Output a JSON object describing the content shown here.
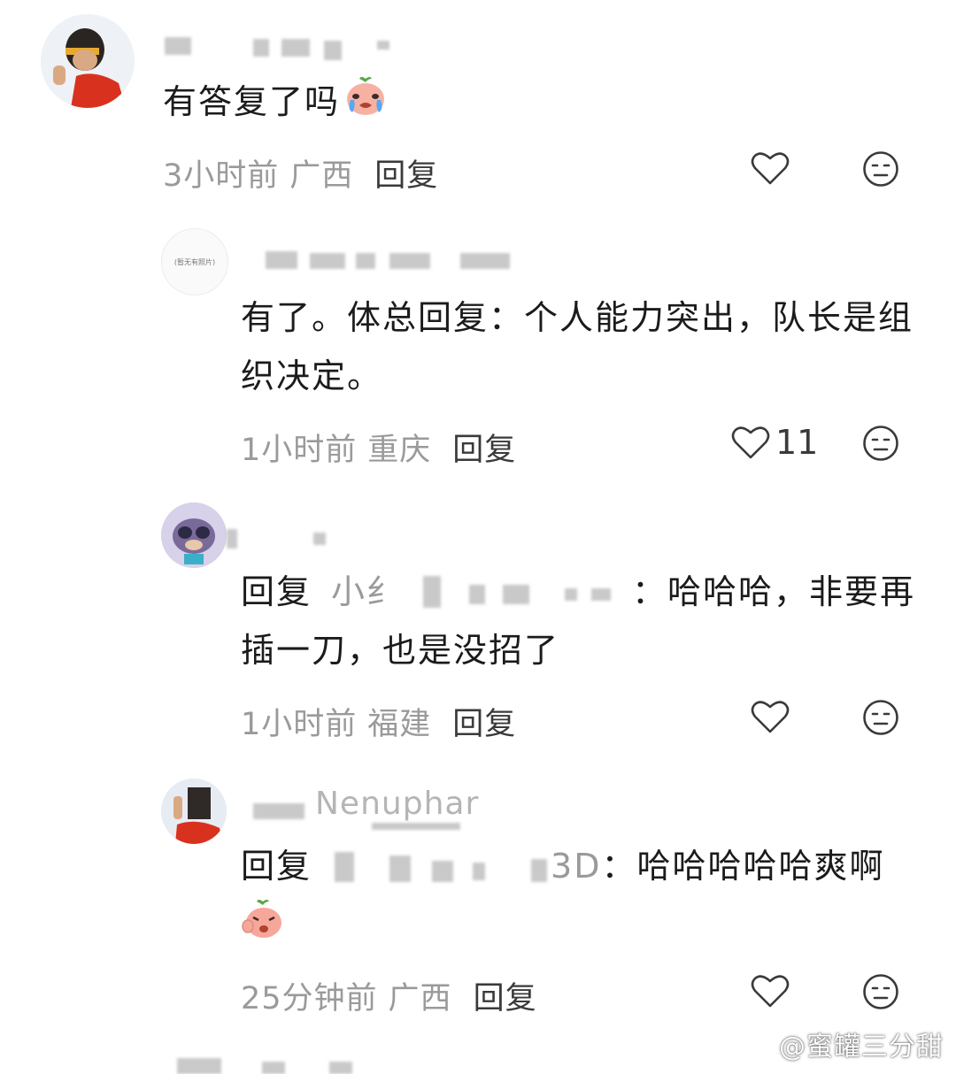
{
  "comments": [
    {
      "content": "有答复了吗",
      "time": "3小时前",
      "location": "广西",
      "reply_label": "回复",
      "likes": ""
    },
    {
      "content": "有了。体总回复：个人能力突出，队长是组织决定。",
      "time": "1小时前",
      "location": "重庆",
      "reply_label": "回复",
      "likes": "11",
      "avatar_text": "(暂无有照片)"
    },
    {
      "reply_prefix": "回复",
      "reply_to": "小纟",
      "content": "：哈哈哈，非要再插一刀，也是没招了",
      "time": "1小时前",
      "location": "福建",
      "reply_label": "回复",
      "likes": ""
    },
    {
      "username": "Nenuphar",
      "reply_prefix": "回复",
      "reply_to": "3D",
      "content": "：哈哈哈哈哈爽啊",
      "time": "25分钟前",
      "location": "广西",
      "reply_label": "回复",
      "likes": ""
    }
  ],
  "watermark": "@蜜罐三分甜",
  "icons": {
    "like": "heart-outline-icon",
    "dislike": "neutral-face-icon"
  }
}
